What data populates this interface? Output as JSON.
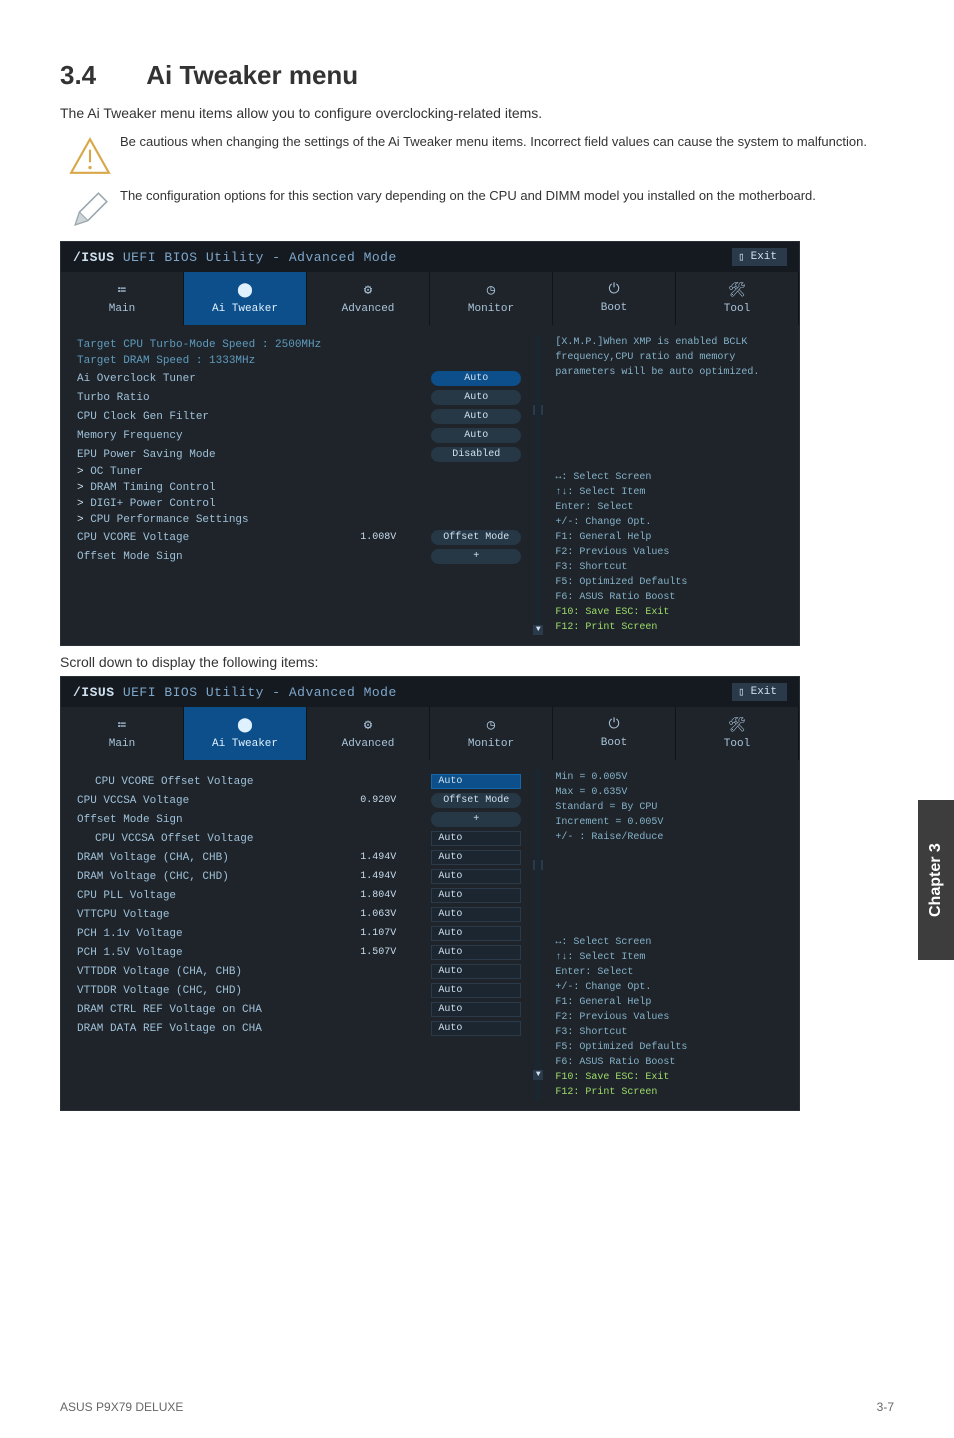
{
  "section": {
    "number": "3.4",
    "title": "Ai Tweaker menu"
  },
  "subtitle": "The Ai Tweaker menu items allow you to configure overclocking-related items.",
  "notes": {
    "warning": "Be cautious when changing the settings of the Ai Tweaker menu items. Incorrect field values can cause the system to malfunction.",
    "info": "The configuration options for this section vary depending on the CPU and DIMM model you installed on the motherboard."
  },
  "bios": {
    "brandTitle": "UEFI BIOS Utility - Advanced Mode",
    "exit": "Exit",
    "tabs": [
      "Main",
      "Ai Tweaker",
      "Advanced",
      "Monitor",
      "Boot",
      "Tool"
    ],
    "readouts": {
      "cpu": "Target CPU Turbo-Mode Speed : 2500MHz",
      "dram": "Target DRAM Speed : 1333MHz"
    },
    "rows1": [
      {
        "label": "Ai Overclock Tuner",
        "value": "Auto",
        "selected": true
      },
      {
        "label": "Turbo Ratio",
        "value": "Auto"
      },
      {
        "label": "CPU Clock Gen Filter",
        "value": "Auto"
      },
      {
        "label": "Memory Frequency",
        "value": "Auto"
      },
      {
        "label": "EPU Power Saving Mode",
        "value": "Disabled"
      },
      {
        "label": "OC Tuner",
        "chev": true
      },
      {
        "label": "DRAM Timing Control",
        "chev": true
      },
      {
        "label": "DIGI+ Power Control",
        "chev": true
      },
      {
        "label": "CPU Performance Settings",
        "chev": true
      },
      {
        "label": "CPU VCORE Voltage",
        "reading": "1.008V",
        "value": "Offset Mode"
      },
      {
        "label": "Offset Mode Sign",
        "value": "+"
      }
    ],
    "help1": "[X.M.P.]When XMP is enabled BCLK frequency,CPU ratio and memory parameters will be auto optimized.",
    "hints": [
      "↔: Select Screen",
      "↑↓: Select Item",
      "Enter: Select",
      "+/-: Change Opt.",
      "F1: General Help",
      "F2: Previous Values",
      "F3: Shortcut",
      "F5: Optimized Defaults",
      "F6: ASUS Ratio Boost",
      "F10: Save  ESC: Exit",
      "F12: Print Screen"
    ],
    "scrollCaption": "Scroll down to display the following items:",
    "rows2": [
      {
        "label": "CPU VCORE Offset Voltage",
        "value": "Auto",
        "input": true,
        "selected": true,
        "indent": true
      },
      {
        "label": "CPU VCCSA Voltage",
        "reading": "0.920V",
        "value": "Offset Mode"
      },
      {
        "label": "Offset Mode Sign",
        "value": "+"
      },
      {
        "label": "CPU VCCSA Offset Voltage",
        "value": "Auto",
        "input": true,
        "indent": true
      },
      {
        "label": "DRAM Voltage (CHA, CHB)",
        "reading": "1.494V",
        "value": "Auto",
        "input": true
      },
      {
        "label": "DRAM Voltage (CHC, CHD)",
        "reading": "1.494V",
        "value": "Auto",
        "input": true
      },
      {
        "label": "CPU PLL Voltage",
        "reading": "1.804V",
        "value": "Auto",
        "input": true
      },
      {
        "label": "VTTCPU Voltage",
        "reading": "1.063V",
        "value": "Auto",
        "input": true
      },
      {
        "label": "PCH 1.1v Voltage",
        "reading": "1.107V",
        "value": "Auto",
        "input": true
      },
      {
        "label": "PCH 1.5V Voltage",
        "reading": "1.507V",
        "value": "Auto",
        "input": true
      },
      {
        "label": "VTTDDR Voltage (CHA, CHB)",
        "value": "Auto",
        "input": true
      },
      {
        "label": "VTTDDR Voltage (CHC, CHD)",
        "value": "Auto",
        "input": true
      },
      {
        "label": "DRAM CTRL REF Voltage on CHA",
        "value": "Auto",
        "input": true
      },
      {
        "label": "DRAM DATA REF Voltage on CHA",
        "value": "Auto",
        "input": true
      }
    ],
    "help2": [
      "Min = 0.005V",
      "Max = 0.635V",
      "Standard = By CPU",
      "Increment = 0.005V",
      "+/- : Raise/Reduce"
    ]
  },
  "chapter": "Chapter 3",
  "footer": {
    "left": "ASUS P9X79 DELUXE",
    "right": "3-7"
  }
}
